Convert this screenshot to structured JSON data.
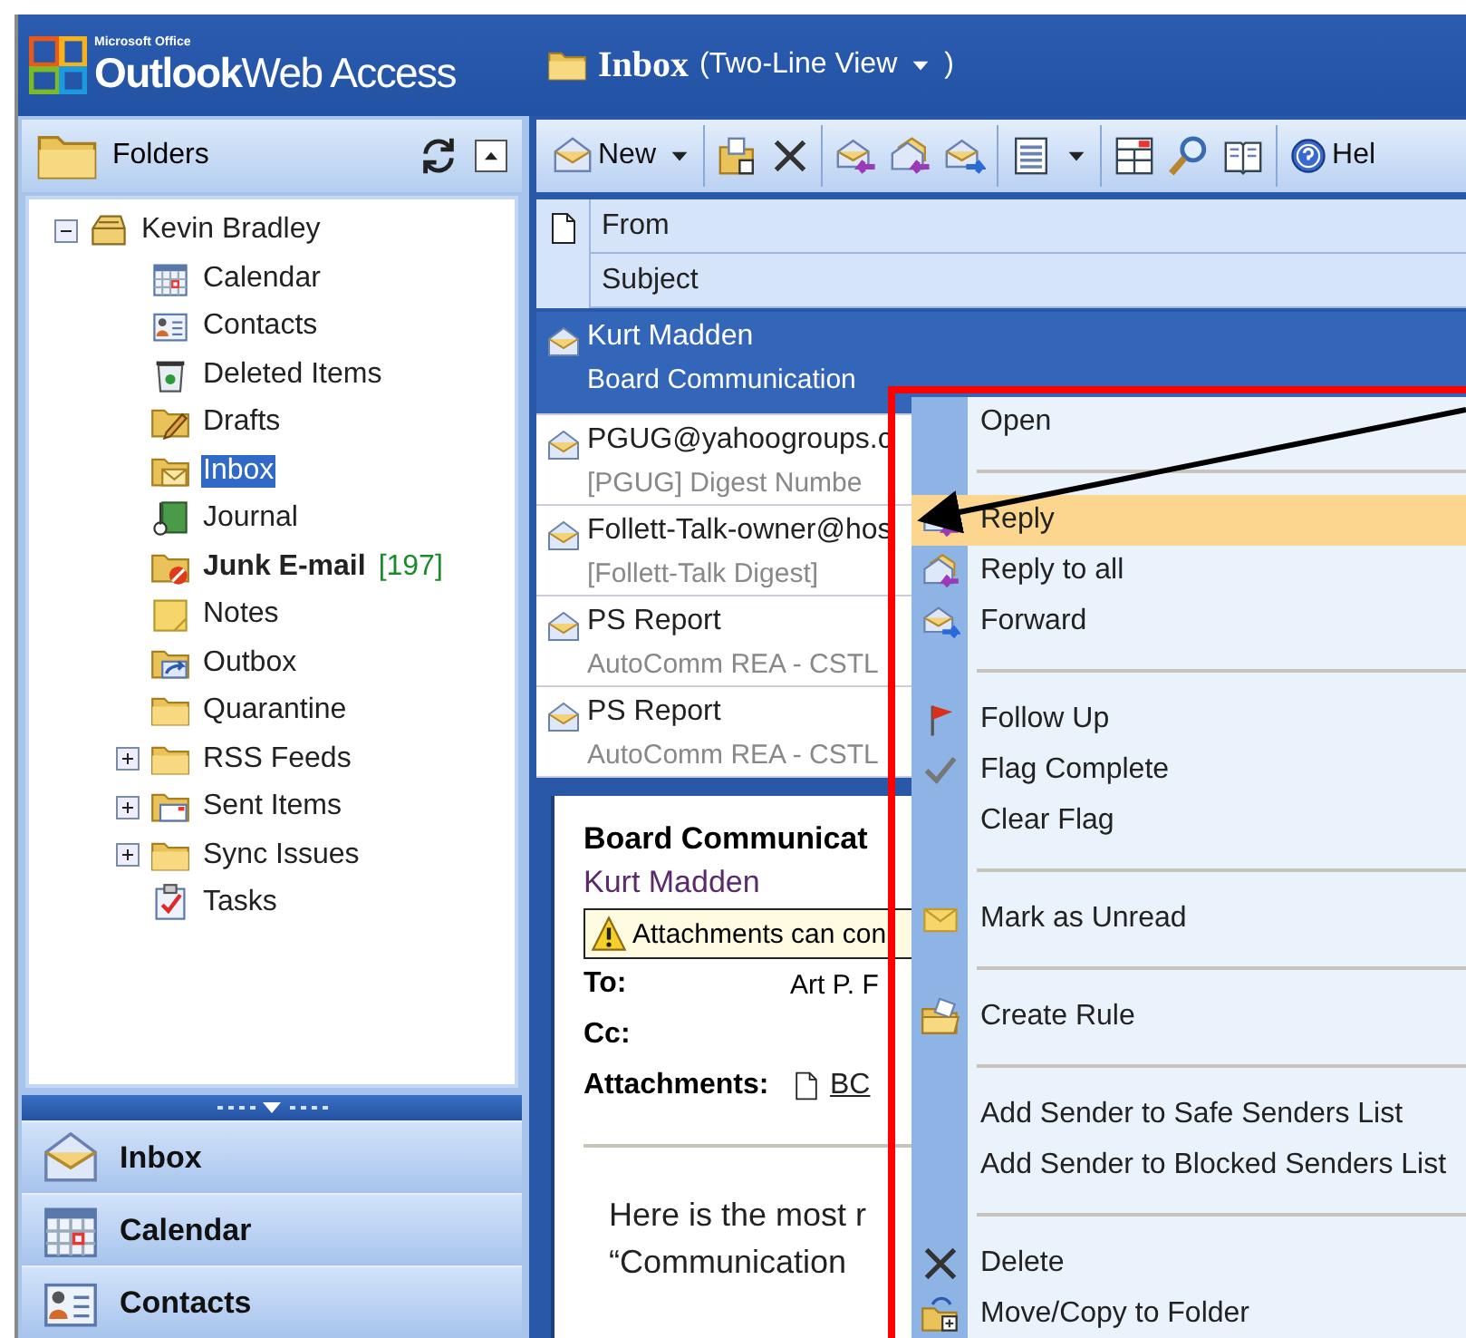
{
  "header": {
    "brand_small": "Microsoft Office",
    "brand": "**Outlook**Web Access",
    "folder_title": "Inbox",
    "view_open": "(Two-Line View",
    "view_close": ")"
  },
  "folders_pane": {
    "title": "Folders"
  },
  "folders": [
    {
      "label": "Kevin Bradley",
      "expanded": true,
      "selected": false,
      "children": [
        {
          "label": "Calendar",
          "selected": false
        },
        {
          "label": "Contacts",
          "selected": false
        },
        {
          "label": "Deleted Items",
          "selected": false
        },
        {
          "label": "Drafts",
          "selected": false
        },
        {
          "label": "Inbox",
          "selected": true
        },
        {
          "label": "Journal",
          "selected": false
        },
        {
          "label": "Junk E-mail",
          "selected": false,
          "unread": true,
          "count": "[197]"
        },
        {
          "label": "Notes",
          "selected": false
        },
        {
          "label": "Outbox",
          "selected": false
        },
        {
          "label": "Quarantine",
          "selected": false
        },
        {
          "label": "RSS Feeds",
          "selected": false,
          "expanded": false
        },
        {
          "label": "Sent Items",
          "selected": false,
          "expanded": false
        },
        {
          "label": "Sync Issues",
          "selected": false,
          "expanded": false
        },
        {
          "label": "Tasks",
          "selected": false
        }
      ]
    }
  ],
  "nav_buttons": [
    {
      "label": "Inbox"
    },
    {
      "label": "Calendar"
    },
    {
      "label": "Contacts"
    }
  ],
  "toolbar": {
    "new_label": "New",
    "help_label": "Hel"
  },
  "list_columns": {
    "from": "From",
    "subject": "Subject"
  },
  "messages": [
    {
      "from": "Kurt Madden",
      "subject": "Board Communication",
      "selected": true
    },
    {
      "from": "PGUG@yahoogroups.c",
      "subject": "[PGUG] Digest Numbe",
      "selected": false
    },
    {
      "from": "Follett-Talk-owner@hos",
      "subject": "[Follett-Talk Digest]",
      "selected": false
    },
    {
      "from": "PS Report",
      "subject": "AutoComm REA - CSTL",
      "selected": false
    },
    {
      "from": "PS Report",
      "subject": "AutoComm REA - CSTL",
      "selected": false
    }
  ],
  "reading_pane": {
    "subject": "Board Communicat",
    "sender": "Kurt Madden",
    "info": "Attachments can con",
    "to_label": "To:",
    "to": "Art P. F",
    "cc_label": "Cc:",
    "attachments_label": "Attachments:",
    "attachment": "BC",
    "body": [
      "Here is the most r",
      "“Communication"
    ]
  },
  "context_menu": [
    {
      "kind": "item",
      "label": "Open",
      "selected": false
    },
    {
      "kind": "separator"
    },
    {
      "kind": "item",
      "label": "Reply",
      "selected": true
    },
    {
      "kind": "item",
      "label": "Reply to all",
      "selected": false
    },
    {
      "kind": "item",
      "label": "Forward",
      "selected": false
    },
    {
      "kind": "separator"
    },
    {
      "kind": "item",
      "label": "Follow Up",
      "selected": false
    },
    {
      "kind": "item",
      "label": "Flag Complete",
      "selected": false
    },
    {
      "kind": "item",
      "label": "Clear Flag",
      "selected": false
    },
    {
      "kind": "separator"
    },
    {
      "kind": "item",
      "label": "Mark as Unread",
      "selected": false
    },
    {
      "kind": "separator"
    },
    {
      "kind": "item",
      "label": "Create Rule",
      "selected": false
    },
    {
      "kind": "separator"
    },
    {
      "kind": "item",
      "label": "Add Sender to Safe Senders List",
      "selected": false
    },
    {
      "kind": "item",
      "label": "Add Sender to Blocked Senders List",
      "selected": false
    },
    {
      "kind": "separator"
    },
    {
      "kind": "item",
      "label": "Delete",
      "selected": false
    },
    {
      "kind": "item",
      "label": "Move/Copy to Folder",
      "selected": false
    }
  ]
}
